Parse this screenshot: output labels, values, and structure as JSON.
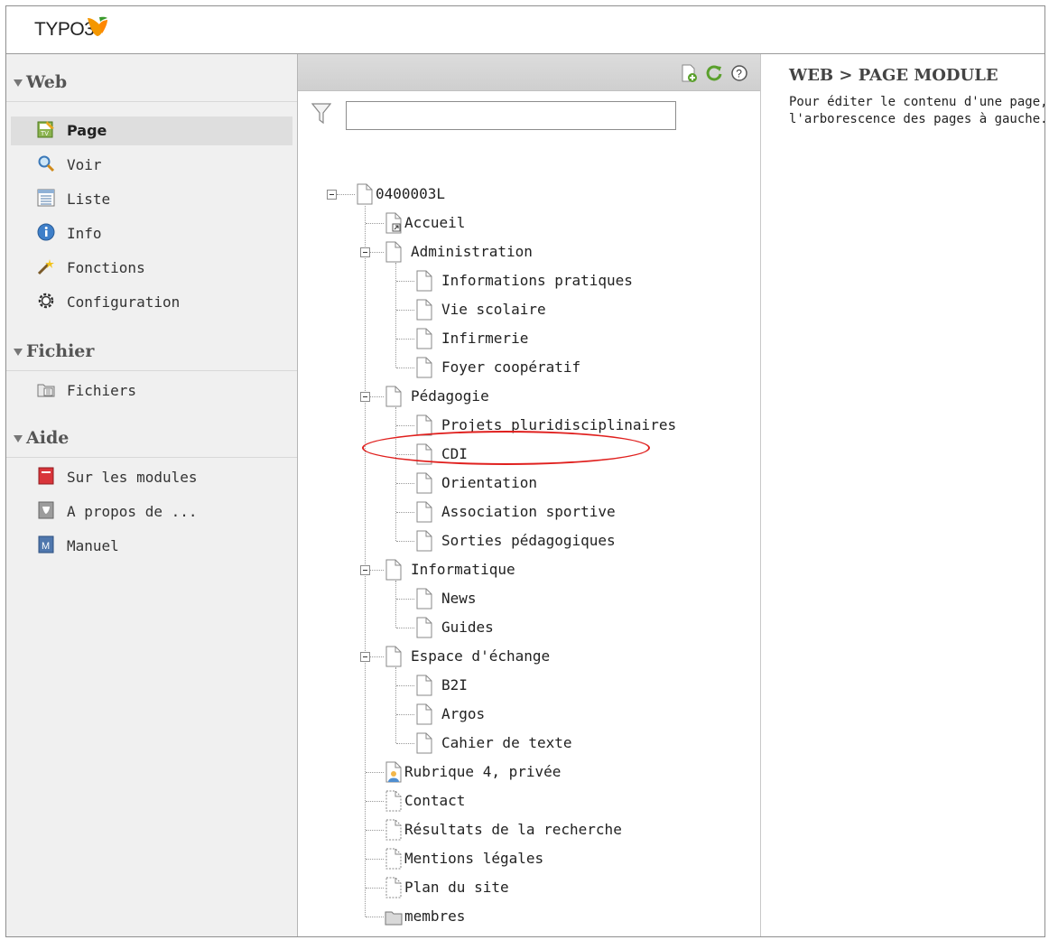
{
  "logo": {
    "text": "TYPO3"
  },
  "module_menu": {
    "groups": [
      {
        "title": "Web",
        "items": [
          {
            "label": "Page",
            "icon": "page-module-icon",
            "active": true
          },
          {
            "label": "Voir",
            "icon": "view-magnifier-icon"
          },
          {
            "label": "Liste",
            "icon": "list-icon"
          },
          {
            "label": "Info",
            "icon": "info-icon"
          },
          {
            "label": "Fonctions",
            "icon": "functions-wand-icon"
          },
          {
            "label": "Configuration",
            "icon": "configuration-gear-icon"
          }
        ]
      },
      {
        "title": "Fichier",
        "items": [
          {
            "label": "Fichiers",
            "icon": "filelist-folder-icon"
          }
        ]
      },
      {
        "title": "Aide",
        "items": [
          {
            "label": "Sur les modules",
            "icon": "about-modules-book-icon"
          },
          {
            "label": "A propos de ...",
            "icon": "about-typo3-icon"
          },
          {
            "label": "Manuel",
            "icon": "manual-icon"
          }
        ]
      }
    ]
  },
  "tree_toolbar": {
    "icons": [
      "new-page-icon",
      "refresh-icon",
      "help-icon"
    ]
  },
  "filter": {
    "value": "",
    "placeholder": ""
  },
  "page_tree": {
    "root": "0400003L",
    "nodes": [
      "Accueil",
      "Administration",
      "Informations pratiques",
      "Vie scolaire",
      "Infirmerie",
      "Foyer coopératif",
      "Pédagogie",
      "Projets pluridisciplinaires",
      "CDI",
      "Orientation",
      "Association sportive",
      "Sorties pédagogiques",
      "Informatique",
      "News",
      "Guides",
      "Espace d'échange",
      "B2I",
      "Argos",
      "Cahier de texte",
      "Rubrique 4, privée",
      "Contact",
      "Résultats de la recherche",
      "Mentions légales",
      "Plan du site",
      "membres"
    ],
    "highlighted": "CDI"
  },
  "content": {
    "title": "WEB > PAGE MODULE",
    "desc_line1": "Pour éditer le contenu d'une page, sélectionnez-la dans",
    "desc_line2": "l'arborescence des pages à gauche."
  },
  "colors": {
    "highlight_ellipse": "#e0201e",
    "toolbar_bg": "#d6d6d6",
    "menu_bg": "#f0f0f0"
  }
}
